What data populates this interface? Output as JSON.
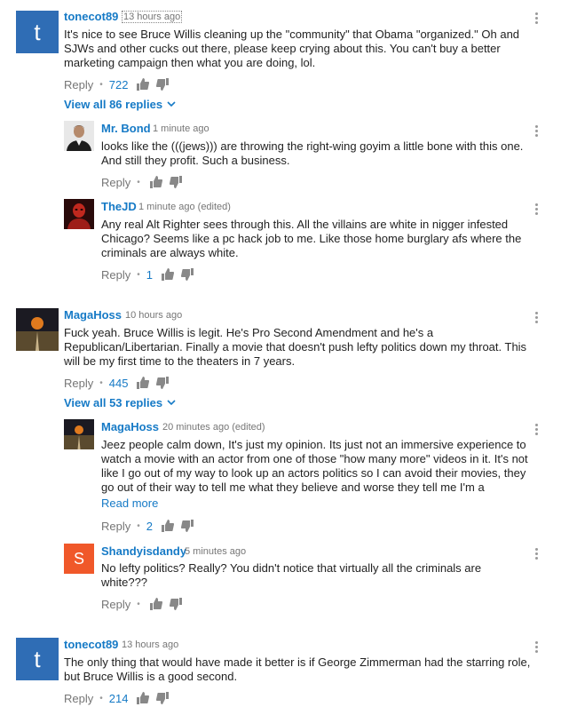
{
  "comments": [
    {
      "avatar_letter": "t",
      "author": "tonecot89",
      "time": "13 hours ago",
      "text": "It's nice to see Bruce Willis cleaning up the \"community\" that Obama \"organized.\" Oh and SJWs and other cucks out there, please keep crying about this. You can't buy a better marketing campaign then what you are doing, lol.",
      "reply_label": "Reply",
      "likes": "722",
      "view_replies": "View all 86 replies",
      "replies": [
        {
          "author": "Mr. Bond",
          "time": "1 minute ago",
          "text": "looks like the (((jews))) are throwing the right-wing goyim a little bone with this one. And still they profit. Such a business.",
          "reply_label": "Reply",
          "likes": ""
        },
        {
          "author": "TheJD",
          "time": "1 minute ago (edited)",
          "text": "Any real Alt Righter sees through this. All the villains are white in nigger infested Chicago? Seems like a pc hack job to me. Like those home burglary afs where the criminals are always white.",
          "reply_label": "Reply",
          "likes": "1"
        }
      ]
    },
    {
      "author": "MagaHoss",
      "time": "10 hours ago",
      "text": "Fuck yeah. Bruce Willis is legit. He's Pro Second Amendment and he's a Republican/Libertarian. Finally a movie that doesn't push lefty politics down my throat. This will be my first time to the theaters in 7 years.",
      "reply_label": "Reply",
      "likes": "445",
      "view_replies": "View all 53 replies",
      "replies": [
        {
          "author": "MagaHoss",
          "time": "20 minutes ago (edited)",
          "text": "Jeez people calm down, It's just my opinion. Its just not an immersive experience to watch a movie with an actor from one of those \"how many more\" videos in it. It's not like I go out of my way to look up an actors politics so I can avoid their movies, they go out of their way to tell me what they believe and worse they tell me I'm a",
          "read_more": "Read more",
          "reply_label": "Reply",
          "likes": "2"
        },
        {
          "avatar_letter": "S",
          "author": "Shandyisdandy",
          "time": "5 minutes ago",
          "text": "No lefty politics? Really?  You didn't notice that virtually all the criminals are white???",
          "reply_label": "Reply",
          "likes": ""
        }
      ]
    },
    {
      "avatar_letter": "t",
      "author": "tonecot89",
      "time": "13 hours ago",
      "text": "The only thing that would have made it better is if George Zimmerman had the starring role, but Bruce Willis is a good second.",
      "reply_label": "Reply",
      "likes": "214"
    }
  ],
  "colors": {
    "link": "#167ac6",
    "meta": "#767676",
    "avatar_blue": "#2f6db5",
    "avatar_orange": "#f0582a"
  }
}
